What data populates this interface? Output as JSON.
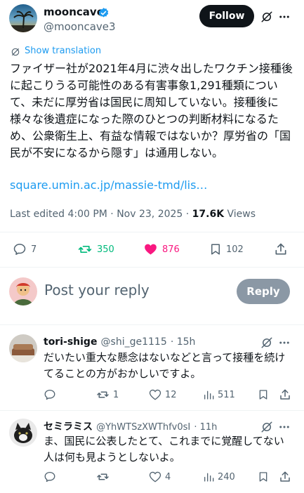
{
  "tweet": {
    "author_name": "mooncave",
    "author_handle": "@mooncave3",
    "follow_label": "Follow",
    "show_translation": "Show translation",
    "body": "ファイザー社が2021年4月に渋々出したワクチン接種後に起こりうる可能性のある有害事象1,291種類について、未だに厚労省は国民に周知していない。接種後に様々な後遺症になった際のひとつの判断材料になるため、公衆衛生上、有益な情報ではないか？厚労省の「国民が不安になるから隠す」は通用しない。",
    "link": "square.umin.ac.jp/massie-tmd/lis…",
    "edited": "Last edited 4:00 PM · Nov 23, 2025 · ",
    "views_count": "17.6K",
    "views_label": " Views",
    "replies": "7",
    "reposts": "350",
    "likes": "876",
    "bookmarks": "102"
  },
  "composer": {
    "placeholder": "Post your reply",
    "reply_label": "Reply"
  },
  "replies": [
    {
      "name": "tori-shige",
      "handle": "@shi_ge1115",
      "time": "· 15h",
      "text": "だいたい重大な懸念はないなどと言って接種を続けてることの方がおかしいですよ。",
      "replies": "",
      "reposts": "1",
      "likes": "12",
      "views": "511"
    },
    {
      "name": "セミラミス",
      "handle": "@YhWTSzXWThfv0sI",
      "time": "· 11h",
      "text": "ま、国民に公表したとて、これまでに覚醒してない人は何も見ようとしないよ。",
      "replies": "",
      "reposts": "",
      "likes": "4",
      "views": "240"
    }
  ],
  "colors": {
    "verified": "#1d9bf0",
    "link": "#1d9bf0",
    "repost_active": "#00ba7c",
    "like_active": "#f91880",
    "follow_bg": "#0f1419",
    "reply_button_bg": "#8b98a5"
  },
  "icons": [
    "grok-icon",
    "more-icon",
    "translate-icon",
    "reply-icon",
    "repost-icon",
    "like-icon",
    "bookmark-icon",
    "share-icon",
    "views-icon",
    "verified-badge-icon"
  ]
}
